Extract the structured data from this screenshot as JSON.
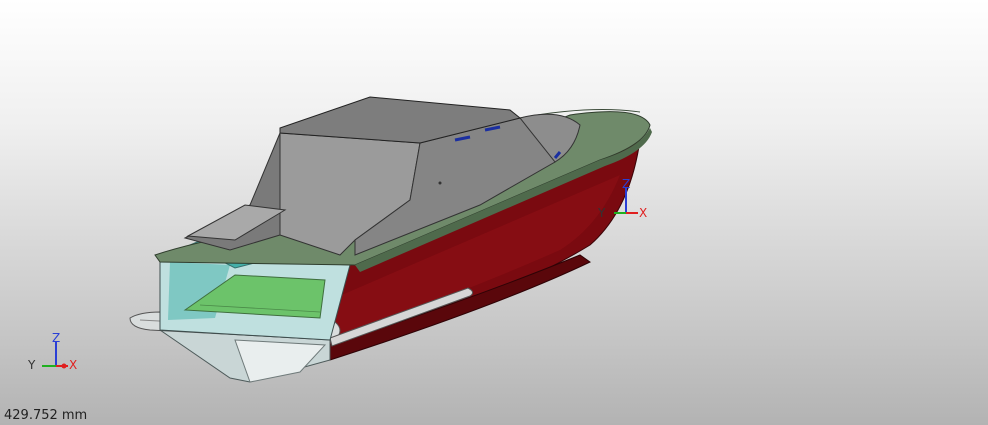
{
  "viewport": {
    "background_top": "#ffffff",
    "background_bottom": "#b3b3b3"
  },
  "model": {
    "hull_color": "#7a0a10",
    "deck_color": "#6f8a6a",
    "cabin_color": "#8c8c8c",
    "glass_color": "#2fa7a0",
    "floor_color": "#6cc36a",
    "transom_color": "#c9d6d6"
  },
  "triad_main": {
    "x": "X",
    "y": "Y",
    "z": "Z"
  },
  "triad_corner": {
    "x": "X",
    "y": "Y",
    "z": "Z"
  },
  "status": {
    "scale": "429.752 mm"
  }
}
